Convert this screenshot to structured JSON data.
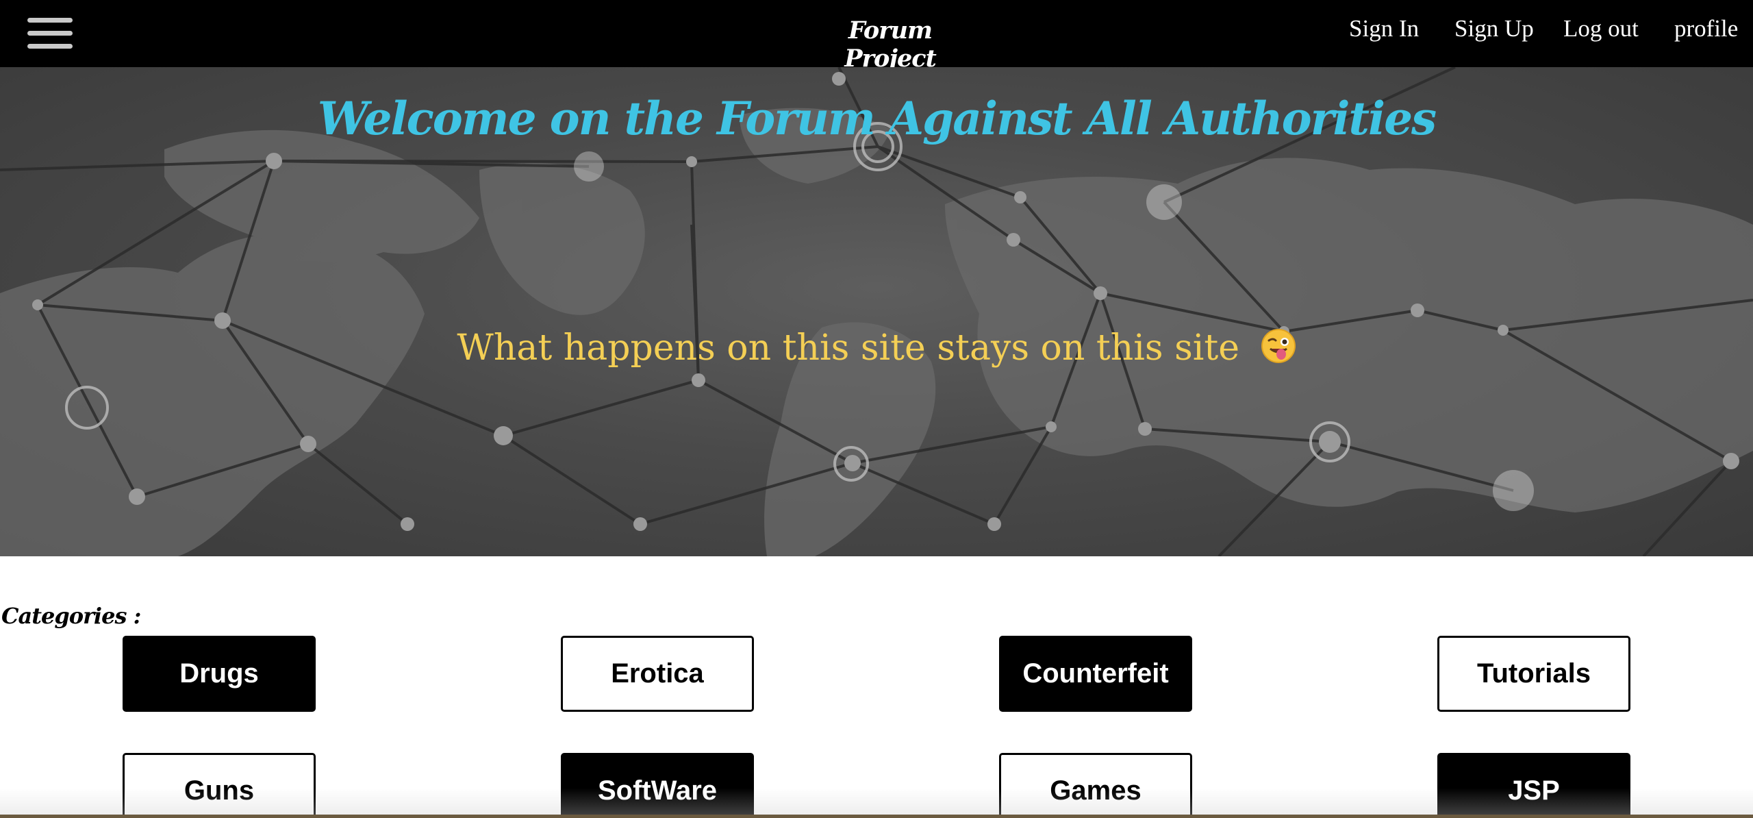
{
  "nav": {
    "menu_icon": "hamburger-menu-icon",
    "brand": "Forum Project",
    "links": {
      "sign_in": "Sign In",
      "sign_up": "Sign Up",
      "log_out": "Log out",
      "profile": "profile"
    }
  },
  "hero": {
    "title": "Welcome on the Forum Against All Authorities",
    "tagline": "What happens on this site stays on this site",
    "tagline_emoji": "winking-face-with-tongue",
    "background": "world-map-network",
    "colors": {
      "title": "#3fc4e4",
      "tagline": "#f4cf55"
    }
  },
  "categories": {
    "label": "Categories :",
    "items": [
      {
        "label": "Drugs",
        "style": "dark"
      },
      {
        "label": "Erotica",
        "style": "light"
      },
      {
        "label": "Counterfeit",
        "style": "dark"
      },
      {
        "label": "Tutorials",
        "style": "light"
      },
      {
        "label": "Guns",
        "style": "light"
      },
      {
        "label": "SoftWare",
        "style": "dark"
      },
      {
        "label": "Games",
        "style": "light"
      },
      {
        "label": "JSP",
        "style": "dark"
      }
    ]
  }
}
